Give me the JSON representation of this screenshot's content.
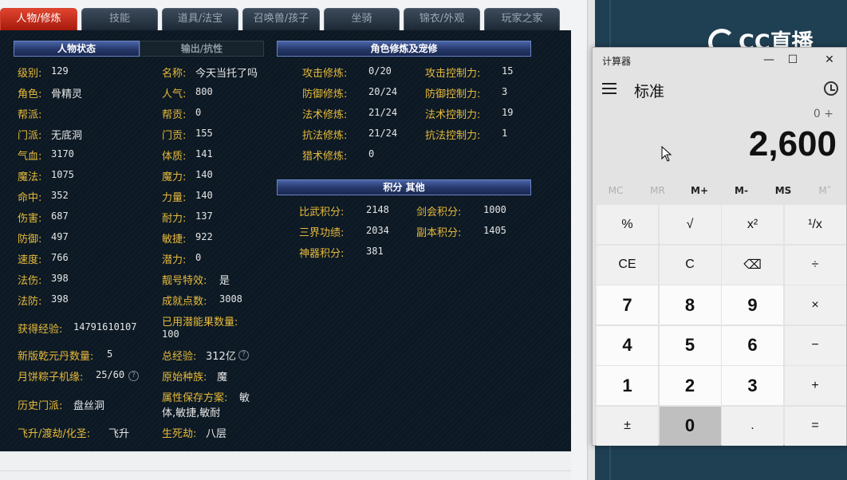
{
  "tabs": [
    {
      "label": "人物/修炼",
      "active": true
    },
    {
      "label": "技能"
    },
    {
      "label": "道具/法宝"
    },
    {
      "label": "召唤兽/孩子"
    },
    {
      "label": "坐骑"
    },
    {
      "label": "锦衣/外观"
    },
    {
      "label": "玩家之家"
    }
  ],
  "status_tabs": {
    "active": "人物状态",
    "inactive": "输出/抗性"
  },
  "stats_left": [
    {
      "label": "级别:",
      "value": "129"
    },
    {
      "label": "角色:",
      "value": "骨精灵"
    },
    {
      "label": "帮派:",
      "value": ""
    },
    {
      "label": "门派:",
      "value": "无底洞"
    },
    {
      "label": "气血:",
      "value": "3170"
    },
    {
      "label": "魔法:",
      "value": "1075"
    },
    {
      "label": "命中:",
      "value": "352"
    },
    {
      "label": "伤害:",
      "value": "687"
    },
    {
      "label": "防御:",
      "value": "497"
    },
    {
      "label": "速度:",
      "value": "766"
    },
    {
      "label": "法伤:",
      "value": "398"
    },
    {
      "label": "法防:",
      "value": "398"
    }
  ],
  "stats_mid": [
    {
      "label": "名称:",
      "value": "今天当托了吗"
    },
    {
      "label": "人气:",
      "value": "800"
    },
    {
      "label": "帮贡:",
      "value": "0"
    },
    {
      "label": "门贡:",
      "value": "155"
    },
    {
      "label": "体质:",
      "value": "141"
    },
    {
      "label": "魔力:",
      "value": "140"
    },
    {
      "label": "力量:",
      "value": "140"
    },
    {
      "label": "耐力:",
      "value": "137"
    },
    {
      "label": "敏捷:",
      "value": "922"
    },
    {
      "label": "潜力:",
      "value": "0"
    },
    {
      "label": "靓号特效:",
      "value": "是"
    },
    {
      "label": "成就点数:",
      "value": "3008"
    }
  ],
  "extra": {
    "exp_label": "获得经验:",
    "exp_value": "14791610107",
    "potion_label": "已用潜能果数量:",
    "potion_value": "100",
    "dan_label": "新版乾元丹数量:",
    "dan_value": "5",
    "total_exp_label": "总经验:",
    "total_exp_value": "312亿",
    "mooncake_label": "月饼粽子机缘:",
    "mooncake_value": "25/60",
    "race_label": "原始种族:",
    "race_value": "魔",
    "hist_label": "历史门派:",
    "hist_value": "盘丝洞",
    "save_label": "属性保存方案:",
    "save_value1": "敏",
    "save_value2": "体,敏捷,敏耐",
    "fly_label": "飞升/渡劫/化圣:",
    "fly_value": "飞升",
    "life_label": "生死劫:",
    "life_value": "八层",
    "qmark": "?"
  },
  "cultivation": {
    "header": "角色修炼及宠修",
    "left": [
      {
        "label": "攻击修炼:",
        "value": "0/20"
      },
      {
        "label": "防御修炼:",
        "value": "20/24"
      },
      {
        "label": "法术修炼:",
        "value": "21/24"
      },
      {
        "label": "抗法修炼:",
        "value": "21/24"
      },
      {
        "label": "猎术修炼:",
        "value": "0"
      }
    ],
    "right": [
      {
        "label": "攻击控制力:",
        "value": "15"
      },
      {
        "label": "防御控制力:",
        "value": "3"
      },
      {
        "label": "法术控制力:",
        "value": "19"
      },
      {
        "label": "抗法控制力:",
        "value": "1"
      }
    ]
  },
  "points": {
    "header": "积分 其他",
    "left": [
      {
        "label": "比武积分:",
        "value": "2148"
      },
      {
        "label": "三界功绩:",
        "value": "2034"
      },
      {
        "label": "神器积分:",
        "value": "381"
      }
    ],
    "right": [
      {
        "label": "剑会积分:",
        "value": "1000"
      },
      {
        "label": "副本积分:",
        "value": "1405"
      }
    ]
  },
  "logo": {
    "text": "CC直播"
  },
  "calculator": {
    "title": "计算器",
    "mode": "标准",
    "expression": "0 +",
    "display": "2,600",
    "memory": [
      "MC",
      "MR",
      "M+",
      "M-",
      "MS",
      "M˅"
    ],
    "keys": [
      "%",
      "√",
      "x²",
      "¹/x",
      "CE",
      "C",
      "⌫",
      "÷",
      "7",
      "8",
      "9",
      "×",
      "4",
      "5",
      "6",
      "−",
      "1",
      "2",
      "3",
      "+",
      "±",
      "0",
      ".",
      "="
    ],
    "window_buttons": {
      "minimize": "—",
      "maximize": "☐",
      "close": "✕"
    }
  }
}
